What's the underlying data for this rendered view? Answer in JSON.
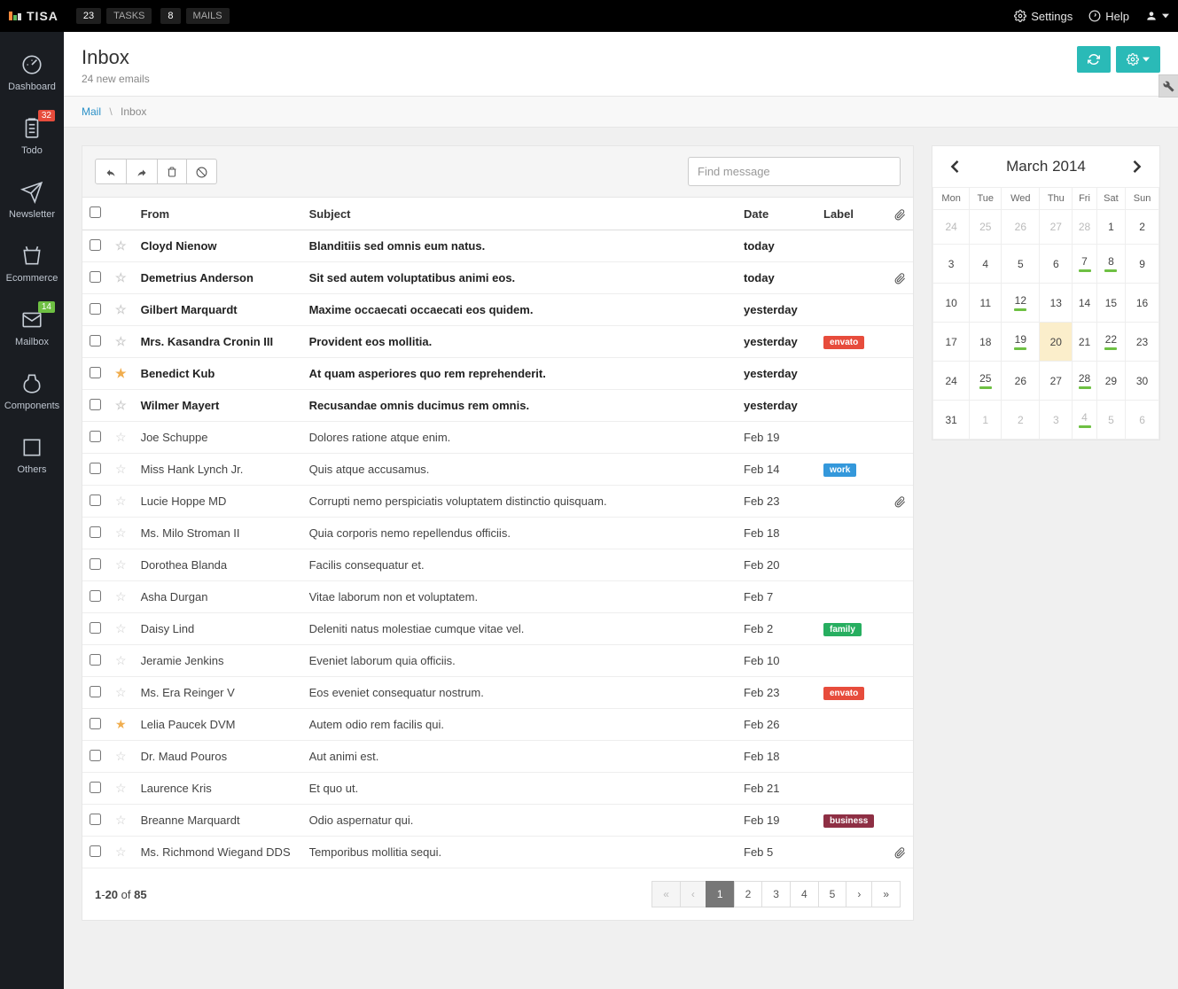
{
  "brand": "TISA",
  "topbar": {
    "tasks_count": "23",
    "tasks_label": "TASKS",
    "mails_count": "8",
    "mails_label": "MAILS",
    "settings": "Settings",
    "help": "Help"
  },
  "sidenav": {
    "items": [
      {
        "label": "Dashboard"
      },
      {
        "label": "Todo",
        "badge": "32"
      },
      {
        "label": "Newsletter"
      },
      {
        "label": "Ecommerce"
      },
      {
        "label": "Mailbox",
        "badge": "14"
      },
      {
        "label": "Components"
      },
      {
        "label": "Others"
      }
    ]
  },
  "page": {
    "title": "Inbox",
    "subtitle": "24 new emails"
  },
  "breadcrumb": {
    "root": "Mail",
    "current": "Inbox"
  },
  "toolbar": {
    "search_placeholder": "Find message"
  },
  "table": {
    "headers": {
      "from": "From",
      "subject": "Subject",
      "date": "Date",
      "label": "Label"
    },
    "rows": [
      {
        "from": "Cloyd Nienow",
        "subject": "Blanditiis sed omnis eum natus.",
        "date": "today",
        "label": "",
        "unread": true,
        "starred": false,
        "attach": false
      },
      {
        "from": "Demetrius Anderson",
        "subject": "Sit sed autem voluptatibus animi eos.",
        "date": "today",
        "label": "",
        "unread": true,
        "starred": false,
        "attach": true
      },
      {
        "from": "Gilbert Marquardt",
        "subject": "Maxime occaecati occaecati eos quidem.",
        "date": "yesterday",
        "label": "",
        "unread": true,
        "starred": false,
        "attach": false
      },
      {
        "from": "Mrs. Kasandra Cronin III",
        "subject": "Provident eos mollitia.",
        "date": "yesterday",
        "label": "envato",
        "unread": true,
        "starred": false,
        "attach": false
      },
      {
        "from": "Benedict Kub",
        "subject": "At quam asperiores quo rem reprehenderit.",
        "date": "yesterday",
        "label": "",
        "unread": true,
        "starred": true,
        "attach": false
      },
      {
        "from": "Wilmer Mayert",
        "subject": "Recusandae omnis ducimus rem omnis.",
        "date": "yesterday",
        "label": "",
        "unread": true,
        "starred": false,
        "attach": false
      },
      {
        "from": "Joe Schuppe",
        "subject": "Dolores ratione atque enim.",
        "date": "Feb 19",
        "label": "",
        "unread": false,
        "starred": false,
        "attach": false
      },
      {
        "from": "Miss Hank Lynch Jr.",
        "subject": "Quis atque accusamus.",
        "date": "Feb 14",
        "label": "work",
        "unread": false,
        "starred": false,
        "attach": false
      },
      {
        "from": "Lucie Hoppe MD",
        "subject": "Corrupti nemo perspiciatis voluptatem distinctio quisquam.",
        "date": "Feb 23",
        "label": "",
        "unread": false,
        "starred": false,
        "attach": true
      },
      {
        "from": "Ms. Milo Stroman II",
        "subject": "Quia corporis nemo repellendus officiis.",
        "date": "Feb 18",
        "label": "",
        "unread": false,
        "starred": false,
        "attach": false
      },
      {
        "from": "Dorothea Blanda",
        "subject": "Facilis consequatur et.",
        "date": "Feb 20",
        "label": "",
        "unread": false,
        "starred": false,
        "attach": false
      },
      {
        "from": "Asha Durgan",
        "subject": "Vitae laborum non et voluptatem.",
        "date": "Feb 7",
        "label": "",
        "unread": false,
        "starred": false,
        "attach": false
      },
      {
        "from": "Daisy Lind",
        "subject": "Deleniti natus molestiae cumque vitae vel.",
        "date": "Feb 2",
        "label": "family",
        "unread": false,
        "starred": false,
        "attach": false
      },
      {
        "from": "Jeramie Jenkins",
        "subject": "Eveniet laborum quia officiis.",
        "date": "Feb 10",
        "label": "",
        "unread": false,
        "starred": false,
        "attach": false
      },
      {
        "from": "Ms. Era Reinger V",
        "subject": "Eos eveniet consequatur nostrum.",
        "date": "Feb 23",
        "label": "envato",
        "unread": false,
        "starred": false,
        "attach": false
      },
      {
        "from": "Lelia Paucek DVM",
        "subject": "Autem odio rem facilis qui.",
        "date": "Feb 26",
        "label": "",
        "unread": false,
        "starred": true,
        "attach": false
      },
      {
        "from": "Dr. Maud Pouros",
        "subject": "Aut animi est.",
        "date": "Feb 18",
        "label": "",
        "unread": false,
        "starred": false,
        "attach": false
      },
      {
        "from": "Laurence Kris",
        "subject": "Et quo ut.",
        "date": "Feb 21",
        "label": "",
        "unread": false,
        "starred": false,
        "attach": false
      },
      {
        "from": "Breanne Marquardt",
        "subject": "Odio aspernatur qui.",
        "date": "Feb 19",
        "label": "business",
        "unread": false,
        "starred": false,
        "attach": false
      },
      {
        "from": "Ms. Richmond Wiegand DDS",
        "subject": "Temporibus mollitia sequi.",
        "date": "Feb 5",
        "label": "",
        "unread": false,
        "starred": false,
        "attach": true
      }
    ]
  },
  "pager": {
    "from": "1",
    "to": "20",
    "sep": "-",
    "of_label": " of ",
    "total": "85",
    "pages": [
      "1",
      "2",
      "3",
      "4",
      "5"
    ],
    "active": "1"
  },
  "calendar": {
    "title": "March 2014",
    "dow": [
      "Mon",
      "Tue",
      "Wed",
      "Thu",
      "Fri",
      "Sat",
      "Sun"
    ],
    "weeks": [
      [
        {
          "d": "24",
          "other": true
        },
        {
          "d": "25",
          "other": true
        },
        {
          "d": "26",
          "other": true
        },
        {
          "d": "27",
          "other": true
        },
        {
          "d": "28",
          "other": true
        },
        {
          "d": "1"
        },
        {
          "d": "2"
        }
      ],
      [
        {
          "d": "3"
        },
        {
          "d": "4"
        },
        {
          "d": "5"
        },
        {
          "d": "6"
        },
        {
          "d": "7",
          "event": true
        },
        {
          "d": "8",
          "event": true
        },
        {
          "d": "9"
        }
      ],
      [
        {
          "d": "10"
        },
        {
          "d": "11"
        },
        {
          "d": "12",
          "event": true
        },
        {
          "d": "13"
        },
        {
          "d": "14"
        },
        {
          "d": "15"
        },
        {
          "d": "16"
        }
      ],
      [
        {
          "d": "17"
        },
        {
          "d": "18"
        },
        {
          "d": "19",
          "event": true
        },
        {
          "d": "20",
          "today": true
        },
        {
          "d": "21"
        },
        {
          "d": "22",
          "event": true
        },
        {
          "d": "23"
        }
      ],
      [
        {
          "d": "24"
        },
        {
          "d": "25",
          "event": true
        },
        {
          "d": "26"
        },
        {
          "d": "27"
        },
        {
          "d": "28",
          "event": true
        },
        {
          "d": "29"
        },
        {
          "d": "30"
        }
      ],
      [
        {
          "d": "31"
        },
        {
          "d": "1",
          "other": true
        },
        {
          "d": "2",
          "other": true
        },
        {
          "d": "3",
          "other": true
        },
        {
          "d": "4",
          "other": true,
          "event": true
        },
        {
          "d": "5",
          "other": true
        },
        {
          "d": "6",
          "other": true
        }
      ]
    ]
  }
}
